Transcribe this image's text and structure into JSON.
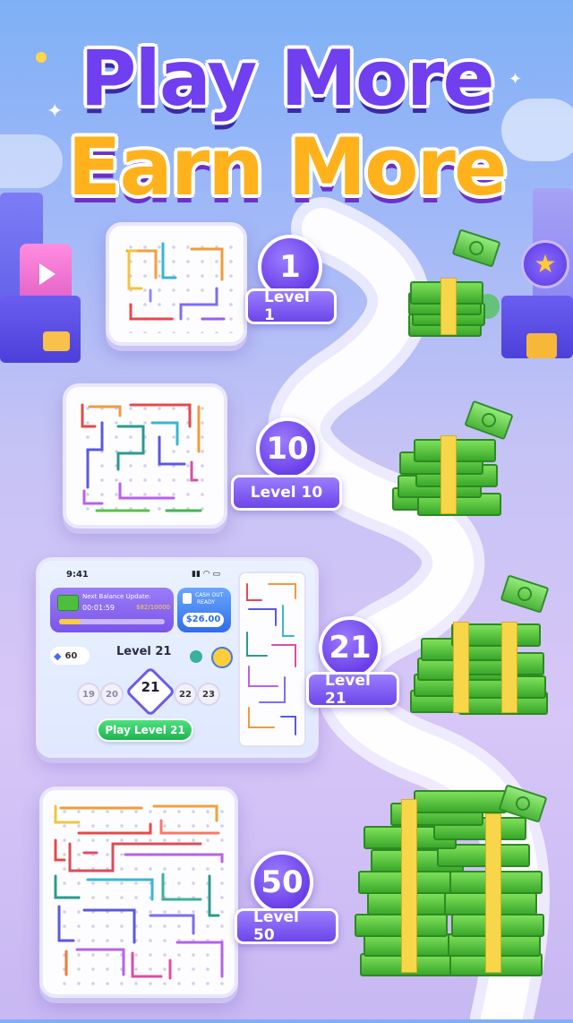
{
  "title": {
    "line1": "Play More",
    "line2": "Earn More"
  },
  "levels": [
    {
      "number": "1",
      "label": "Level 1"
    },
    {
      "number": "10",
      "label": "Level 10"
    },
    {
      "number": "21",
      "label": "Level 21"
    },
    {
      "number": "50",
      "label": "Level 50"
    }
  ],
  "phone": {
    "time": "9:41",
    "balance_label": "Next Balance Update:",
    "timer": "00:01:59",
    "progress": "$82/10000",
    "progress_fraction": 0.2,
    "cashout_label_1": "CASH OUT",
    "cashout_label_2": "READY",
    "cashout_amount": "$26.00",
    "gems": "60",
    "level_title": "Level 21",
    "level_selector": [
      "19",
      "20",
      "21",
      "22",
      "23"
    ],
    "play_button": "Play Level 21"
  },
  "colors": {
    "accent_purple": "#6f3ff0",
    "title_yellow": "#ffb21c",
    "money_green": "#3aa82b",
    "play_green": "#1fb451"
  }
}
